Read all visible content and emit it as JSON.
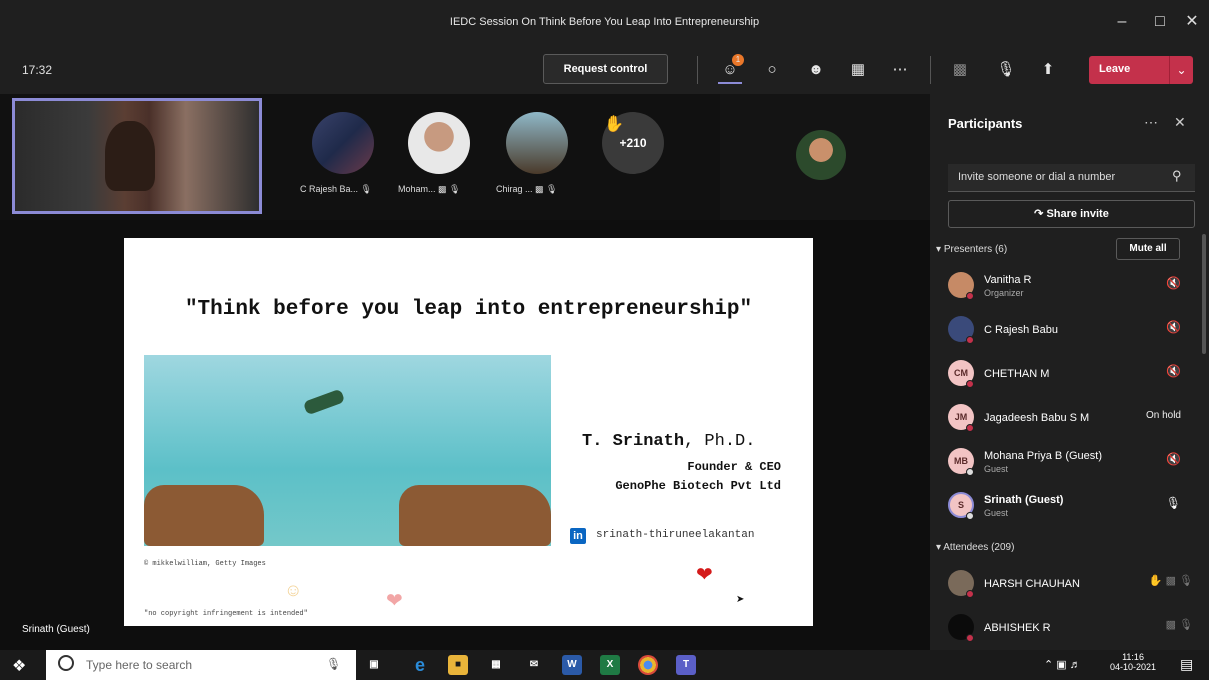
{
  "window": {
    "title": "IEDC Session On Think Before You Leap Into Entrepreneurship"
  },
  "toolbar": {
    "elapsed": "17:32",
    "request_control": "Request control",
    "participants_badge": "1",
    "leave_label": "Leave"
  },
  "strip": {
    "tiles": [
      {
        "label": "C Rajesh Ba..."
      },
      {
        "label": "Moham..."
      },
      {
        "label": "Chirag ..."
      }
    ],
    "more_count": "+210"
  },
  "slide": {
    "headline": "\"Think before you leap into entrepreneurship\"",
    "speaker": "T. Srinath",
    "degree": ", Ph.D.",
    "role": "Founder & CEO",
    "company": "GenoPhe Biotech Pvt Ltd",
    "linkedin": "srinath-thiruneelakantan",
    "credit": "© mikkelwilliam, Getty Images",
    "copyright": "\"no copyright infringement is intended\""
  },
  "presenter_label": "Srinath (Guest)",
  "panel": {
    "title": "Participants",
    "invite_placeholder": "Invite someone or dial a number",
    "share_invite": "Share invite",
    "presenters_header": "Presenters (6)",
    "mute_all": "Mute all",
    "presenters": [
      {
        "name": "Vanitha R",
        "role": "Organizer",
        "initials": ""
      },
      {
        "name": "C Rajesh Babu",
        "role": "",
        "initials": ""
      },
      {
        "name": "CHETHAN M",
        "role": "",
        "initials": "CM"
      },
      {
        "name": "Jagadeesh Babu S M",
        "role": "",
        "initials": "JM",
        "status": "On hold"
      },
      {
        "name": "Mohana Priya B (Guest)",
        "role": "Guest",
        "initials": "MB"
      },
      {
        "name": "Srinath (Guest)",
        "role": "Guest",
        "initials": "S"
      }
    ],
    "attendees_header": "Attendees (209)",
    "attendees": [
      {
        "name": "HARSH CHAUHAN"
      },
      {
        "name": "ABHISHEK R"
      }
    ]
  },
  "taskbar": {
    "search_placeholder": "Type here to search",
    "time": "11:16",
    "date": "04-10-2021"
  }
}
